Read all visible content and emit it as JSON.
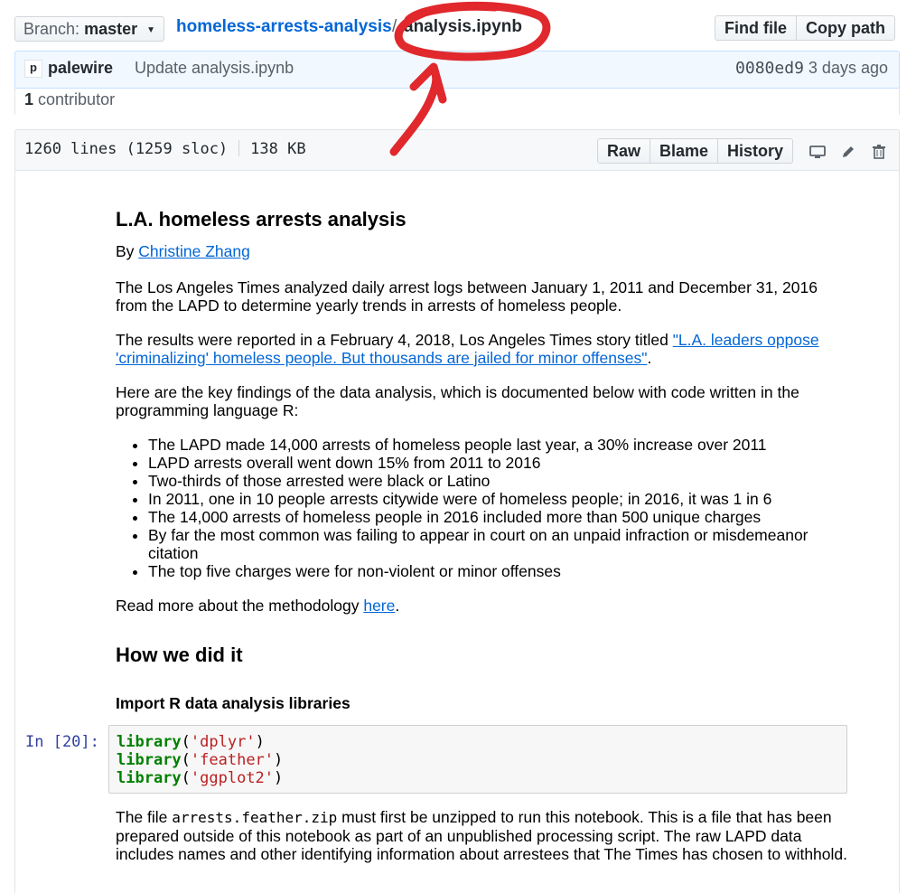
{
  "header": {
    "branch_label": "Branch:",
    "branch_value": "master",
    "repo": "homeless-arrests-analysis",
    "separator": "/",
    "file": "analysis.ipynb",
    "find_file": "Find file",
    "copy_path": "Copy path"
  },
  "commit": {
    "avatar_letter": "p",
    "author": "palewire",
    "message": "Update analysis.ipynb",
    "sha": "0080ed9",
    "age": "3 days ago",
    "contributors_count": "1",
    "contributors_label": "contributor"
  },
  "file_header": {
    "lines": "1260 lines (1259 sloc)",
    "size": "138 KB",
    "raw": "Raw",
    "blame": "Blame",
    "history": "History"
  },
  "notebook": {
    "title": "L.A. homeless arrests analysis",
    "byline_prefix": "By ",
    "author_link": "Christine Zhang",
    "para1": "The Los Angeles Times analyzed daily arrest logs between January 1, 2011 and December 31, 2016 from the LAPD to determine yearly trends in arrests of homeless people.",
    "para2_prefix": "The results were reported in a February 4, 2018, Los Angeles Times story titled ",
    "para2_link": "\"L.A. leaders oppose 'criminalizing' homeless people. But thousands are jailed for minor offenses\"",
    "para2_suffix": ".",
    "para3": "Here are the key findings of the data analysis, which is documented below with code written in the programming language R:",
    "findings": [
      "The LAPD made 14,000 arrests of homeless people last year, a 30% increase over 2011",
      "LAPD arrests overall went down 15% from 2011 to 2016",
      "Two-thirds of those arrested were black or Latino",
      "In 2011, one in 10 people arrests citywide were of homeless people; in 2016, it was 1 in 6",
      "The 14,000 arrests of homeless people in 2016 included more than 500 unique charges",
      "By far the most common was failing to appear in court on an unpaid infraction or misdemeanor citation",
      "The top five charges were for non-violent or minor offenses"
    ],
    "read_more_prefix": "Read more about the methodology ",
    "read_more_link": "here",
    "read_more_suffix": ".",
    "section_heading": "How we did it",
    "subheading": "Import R data analysis libraries",
    "prompt": "In [20]:",
    "code_lines": [
      {
        "fn": "library",
        "arg": "'dplyr'"
      },
      {
        "fn": "library",
        "arg": "'feather'"
      },
      {
        "fn": "library",
        "arg": "'ggplot2'"
      }
    ],
    "para4_prefix": "The file ",
    "para4_code": "arrests.feather.zip",
    "para4_suffix": " must first be unzipped to run this notebook. This is a file that has been prepared outside of this notebook as part of an unpublished processing script. The raw LAPD data includes names and other identifying information about arrestees that The Times has chosen to withhold."
  },
  "colors": {
    "link": "#0366d6",
    "annotation": "#e0282d",
    "code_keyword": "#008000",
    "code_string": "#ba2121",
    "prompt": "#303f9f"
  },
  "icons": [
    "caret-down-icon",
    "desktop-icon",
    "pencil-icon",
    "trash-icon"
  ]
}
